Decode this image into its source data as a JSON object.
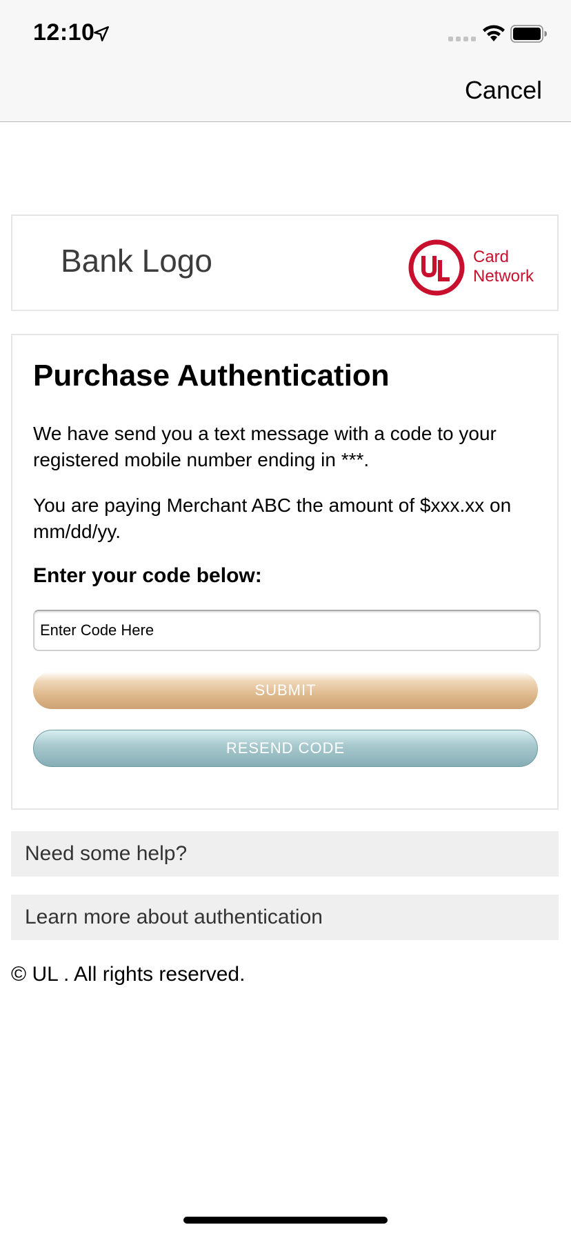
{
  "status_bar": {
    "time": "12:10",
    "icons": [
      "location-arrow-icon",
      "signal-icon",
      "wifi-icon",
      "battery-icon"
    ]
  },
  "nav": {
    "cancel_label": "Cancel"
  },
  "logos": {
    "bank_logo_text": "Bank Logo",
    "network_logo_letters": "UL",
    "network_name_line1": "Card",
    "network_name_line2": "Network"
  },
  "auth": {
    "title": "Purchase Authentication",
    "message_sms": "We have send you a text message with a code to your registered mobile number ending in ***.",
    "message_payment": "You are paying Merchant ABC the amount of $xxx.xx on mm/dd/yy.",
    "code_label": "Enter your code below:",
    "code_input_value": "",
    "code_input_placeholder": "Enter Code Here",
    "submit_label": "SUBMIT",
    "resend_label": "RESEND CODE"
  },
  "help": {
    "need_help_label": "Need some help?",
    "learn_more_label": "Learn more about authentication"
  },
  "footer": {
    "copyright": "© UL . All rights reserved."
  },
  "colors": {
    "network_red": "#c8102e",
    "submit_gold": "#dcb689",
    "resend_teal": "#86aeb5",
    "help_bg": "#efefef"
  }
}
